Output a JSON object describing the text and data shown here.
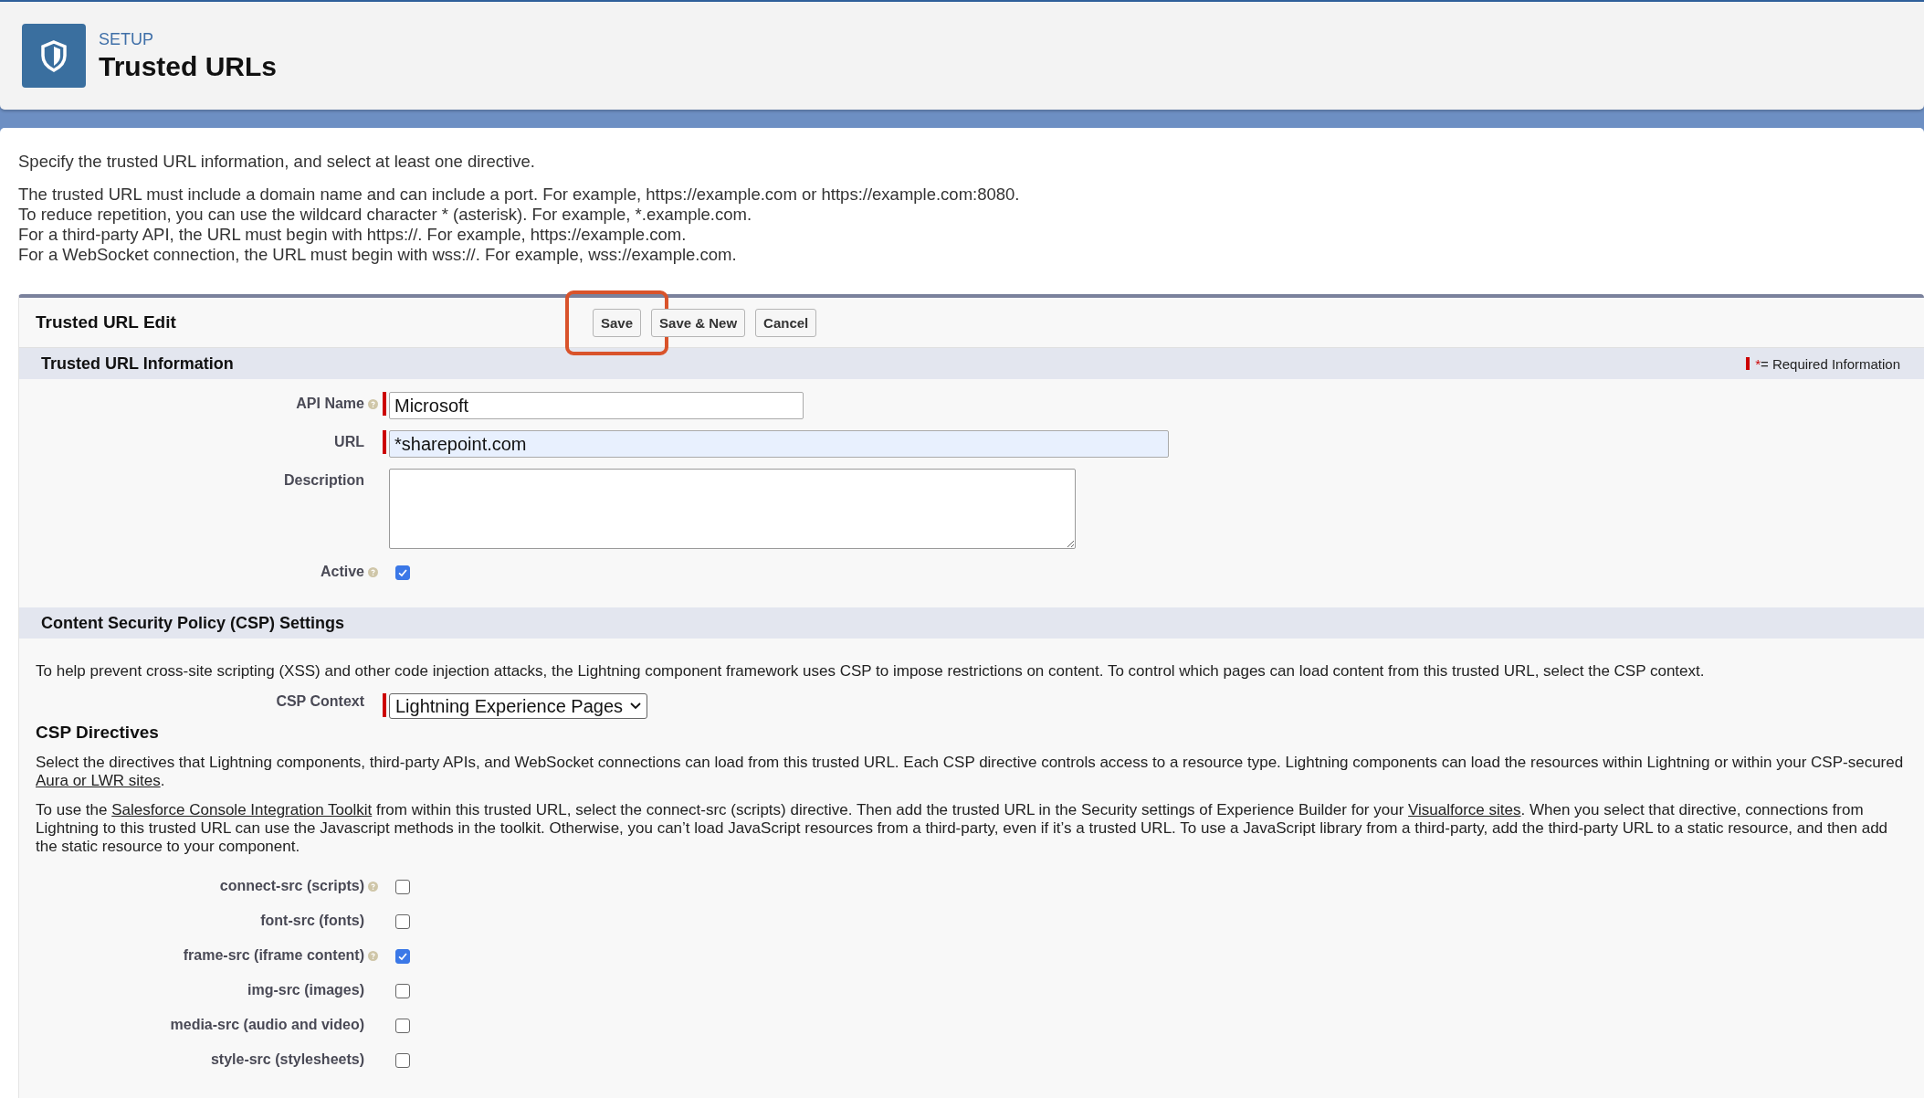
{
  "header": {
    "eyebrow": "SETUP",
    "title": "Trusted URLs"
  },
  "intro": {
    "lead": "Specify the trusted URL information, and select at least one directive.",
    "lines": [
      "The trusted URL must include a domain name and can include a port. For example, https://example.com or https://example.com:8080.",
      "To reduce repetition, you can use the wildcard character * (asterisk). For example, *.example.com.",
      "For a third-party API, the URL must begin with https://. For example, https://example.com.",
      "For a WebSocket connection, the URL must begin with wss://. For example, wss://example.com."
    ]
  },
  "form": {
    "title": "Trusted URL Edit",
    "buttons": [
      {
        "label": "Save",
        "highlighted": true
      },
      {
        "label": "Save & New",
        "highlighted": false
      },
      {
        "label": "Cancel",
        "highlighted": false
      }
    ],
    "section": {
      "title": "Trusted URL Information",
      "required_legend": "= Required Information",
      "required_mark": "*"
    },
    "fields": [
      {
        "kind": "text",
        "label": "API Name",
        "help": true,
        "required": true,
        "value": "Microsoft",
        "autofilled": false
      },
      {
        "kind": "text",
        "label": "URL",
        "help": false,
        "required": true,
        "value": "*sharepoint.com",
        "autofilled": true
      },
      {
        "kind": "textarea",
        "label": "Description",
        "help": false,
        "required": false
      },
      {
        "kind": "checkbox",
        "label": "Active",
        "help": true,
        "required": false,
        "checked": true
      }
    ]
  },
  "csp": {
    "title": "Content Security Policy (CSP) Settings",
    "description": "To help prevent cross-site scripting (XSS) and other code injection attacks, the Lightning component framework uses CSP to impose restrictions on content. To control which pages can load content from this trusted URL, select the CSP context.",
    "context": {
      "label": "CSP Context",
      "value": "Lightning Experience Pages",
      "required": true
    },
    "directives_title": "CSP Directives",
    "paragraphs": [
      [
        {
          "text": "Select the directives that Lightning components, third-party APIs, and WebSocket connections can load from this trusted URL. Each CSP directive controls access to a resource type. Lightning components can load the resources within Lightning or within your CSP-secured ",
          "link": false
        },
        {
          "text": "Aura or LWR sites",
          "link": true
        },
        {
          "text": ".",
          "link": false
        }
      ],
      [
        {
          "text": "To use the ",
          "link": false
        },
        {
          "text": "Salesforce Console Integration Toolkit",
          "link": true
        },
        {
          "text": " from within this trusted URL, select the connect-src (scripts) directive. Then add the trusted URL in the Security settings of Experience Builder for your ",
          "link": false
        },
        {
          "text": "Visualforce sites",
          "link": true
        },
        {
          "text": ". When you select that directive, connections from Lightning to this trusted URL can use the Javascript methods in the toolkit. Otherwise, you can’t load JavaScript resources from a third-party, even if it’s a trusted URL. To use a JavaScript library from a third-party, add the third-party URL to a static resource, and then add the static resource to your component.",
          "link": false
        }
      ]
    ],
    "directives": [
      {
        "label": "connect-src (scripts)",
        "help": true,
        "checked": false
      },
      {
        "label": "font-src (fonts)",
        "help": false,
        "checked": false
      },
      {
        "label": "frame-src (iframe content)",
        "help": true,
        "checked": true
      },
      {
        "label": "img-src (images)",
        "help": false,
        "checked": false
      },
      {
        "label": "media-src (audio and video)",
        "help": false,
        "checked": false
      },
      {
        "label": "style-src (stylesheets)",
        "help": false,
        "checked": false
      }
    ]
  }
}
